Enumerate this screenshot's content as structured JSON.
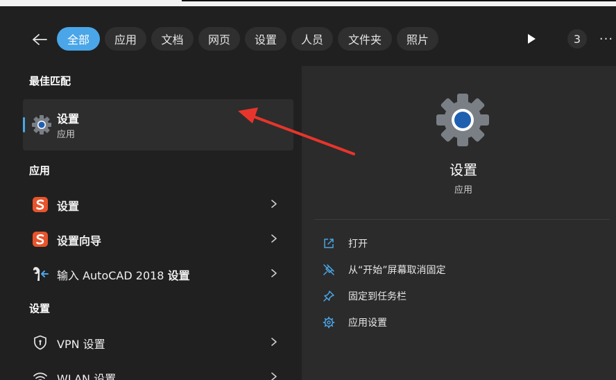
{
  "filters": {
    "back_icon": "arrow-left-icon",
    "chips": [
      "全部",
      "应用",
      "文档",
      "网页",
      "设置",
      "人员",
      "文件夹",
      "照片"
    ],
    "active": "全部",
    "play_icon": "play-icon",
    "count": "3",
    "more_label": "···"
  },
  "left": {
    "best_match_title": "最佳匹配",
    "best_match": {
      "title": "设置",
      "subtitle": "应用",
      "icon": "settings-gear-icon"
    },
    "apps_title": "应用",
    "apps": [
      {
        "label": "设置",
        "icon": "sogou-s-icon"
      },
      {
        "label": "设置向导",
        "icon": "sogou-s-icon"
      },
      {
        "label_prefix": "输入 AutoCAD 2018",
        "label_bold": "设置",
        "icon": "tools-icon"
      }
    ],
    "settings_title": "设置",
    "settings": [
      {
        "label": "VPN 设置",
        "icon": "shield-icon"
      },
      {
        "label": "WLAN 设置",
        "icon": "wifi-icon"
      }
    ]
  },
  "detail": {
    "icon": "settings-gear-icon",
    "name": "设置",
    "kind": "应用",
    "actions": [
      {
        "label": "打开",
        "icon": "open-external-icon"
      },
      {
        "label": "从“开始”屏幕取消固定",
        "icon": "unpin-icon"
      },
      {
        "label": "固定到任务栏",
        "icon": "pin-icon"
      },
      {
        "label": "应用设置",
        "icon": "gear-icon"
      }
    ]
  },
  "colors": {
    "accent": "#4aa6e8",
    "annotation_arrow": "#e8352b",
    "background": "#202020",
    "panel": "#2b2b2b"
  }
}
